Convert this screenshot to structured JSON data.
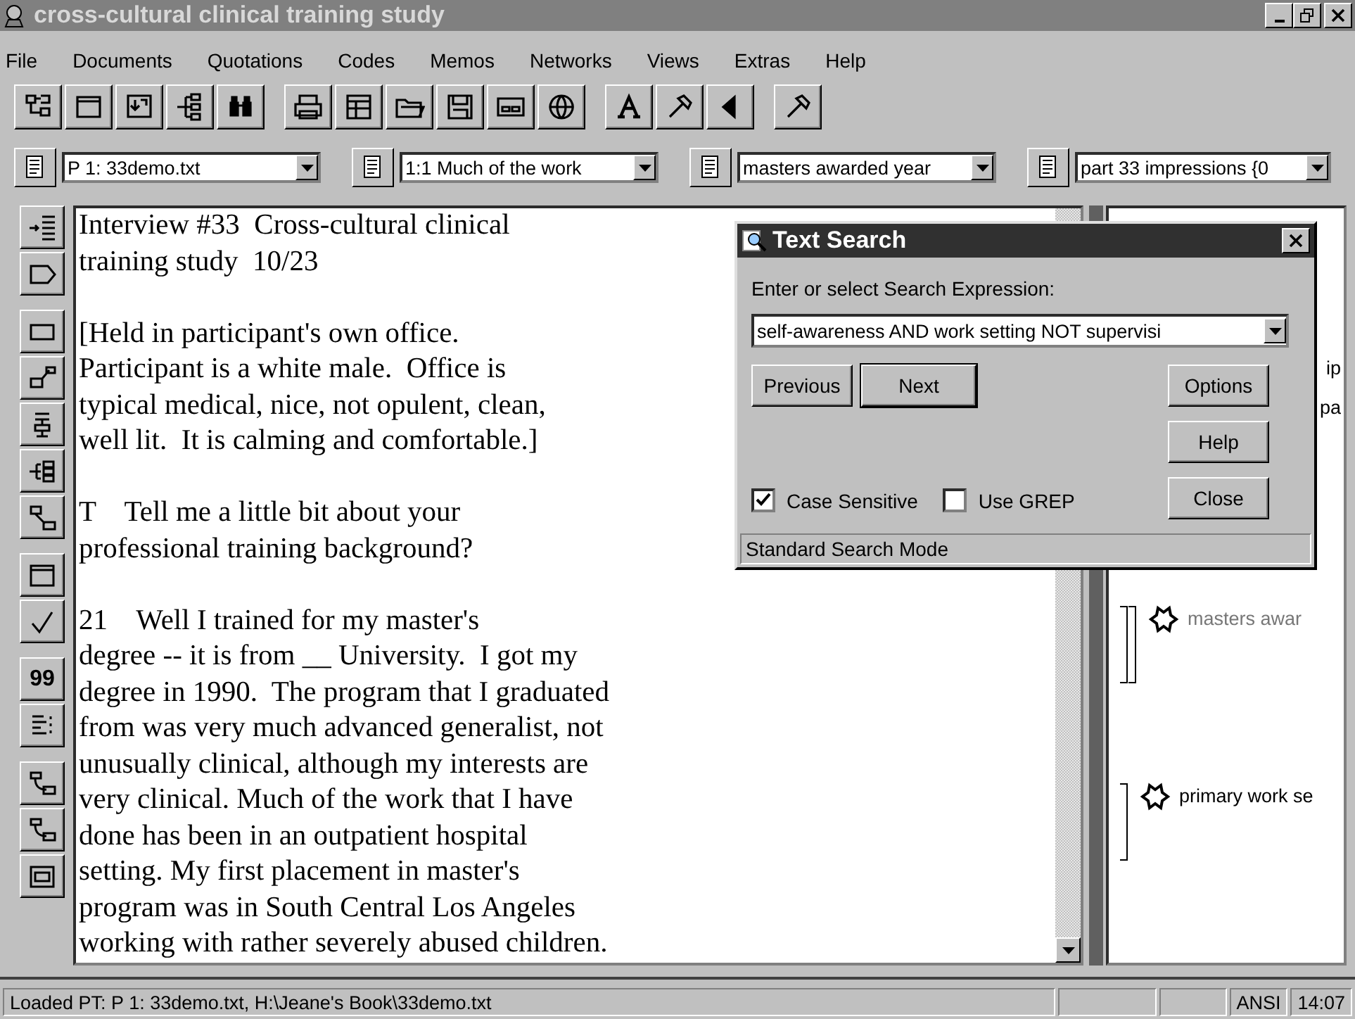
{
  "window": {
    "title": "cross-cultural clinical training study"
  },
  "menu": [
    "File",
    "Documents",
    "Quotations",
    "Codes",
    "Memos",
    "Networks",
    "Views",
    "Extras",
    "Help"
  ],
  "toolbar": [
    {
      "kind": "network"
    },
    {
      "kind": "window"
    },
    {
      "kind": "import"
    },
    {
      "kind": "tree"
    },
    {
      "kind": "binoculars"
    },
    {
      "kind": "gap"
    },
    {
      "kind": "printer"
    },
    {
      "kind": "table"
    },
    {
      "kind": "folder"
    },
    {
      "kind": "disk"
    },
    {
      "kind": "panel"
    },
    {
      "kind": "globe"
    },
    {
      "kind": "gap"
    },
    {
      "kind": "font"
    },
    {
      "kind": "hammer"
    },
    {
      "kind": "back"
    },
    {
      "kind": "gap"
    },
    {
      "kind": "hammer"
    }
  ],
  "selectors": [
    {
      "value": "P 1: 33demo.txt"
    },
    {
      "value": "1:1 Much of the work"
    },
    {
      "value": "masters awarded year"
    },
    {
      "value": "part 33 impressions {0"
    }
  ],
  "side_tools": [
    {
      "kind": "indent"
    },
    {
      "kind": "tag"
    },
    {
      "kind": "gap"
    },
    {
      "kind": "rect"
    },
    {
      "kind": "link"
    },
    {
      "kind": "tree"
    },
    {
      "kind": "branch"
    },
    {
      "kind": "connect"
    },
    {
      "kind": "gap"
    },
    {
      "kind": "window"
    },
    {
      "kind": "check"
    },
    {
      "kind": "gap"
    },
    {
      "kind": "quote",
      "label": "99"
    },
    {
      "kind": "lines"
    },
    {
      "kind": "gap"
    },
    {
      "kind": "flow"
    },
    {
      "kind": "flow"
    },
    {
      "kind": "screen"
    }
  ],
  "document": {
    "paragraphs": [
      [
        "Interview #33  Cross-cultural clinical",
        "training study  10/23"
      ],
      [
        "[Held in participant's own office.",
        "Participant is a white male.  Office is",
        "typical medical, nice, not opulent, clean,",
        "well lit.  It is calming and comfortable.]"
      ],
      [
        "T    Tell me a little bit about your",
        "professional training background?"
      ],
      [
        "21    Well I trained for my master's",
        "degree -- it is from __ University.  I got my",
        "degree in 1990.  The program that I graduated",
        "from was very much advanced generalist, not",
        "unusually clinical, although my interests are",
        "very clinical. Much of the work that I have",
        "done has been in an outpatient hospital",
        "setting. My first placement in master's",
        "program was in South Central Los Angeles",
        "working with rather severely abused children."
      ]
    ]
  },
  "margin": {
    "fragments": [
      "ip",
      "pa"
    ],
    "codes": [
      {
        "label": "masters awar",
        "kind": "double"
      },
      {
        "label": "primary work se",
        "kind": "single"
      }
    ]
  },
  "dialog": {
    "title": "Text Search",
    "prompt": "Enter or select Search Expression:",
    "expression": "self-awareness AND work setting NOT supervisi",
    "buttons": [
      {
        "label": "Previous",
        "default": false
      },
      {
        "label": "Next",
        "default": true
      },
      {
        "label": "Options",
        "default": false
      },
      {
        "label": "Help",
        "default": false
      },
      {
        "label": "Close",
        "default": false
      }
    ],
    "options": [
      {
        "label": "Case Sensitive",
        "checked": true
      },
      {
        "label": "Use GREP",
        "checked": false
      }
    ],
    "status": "Standard Search Mode"
  },
  "status_bar": {
    "message": "Loaded PT: P 1: 33demo.txt, H:\\Jeane's Book\\33demo.txt",
    "encoding": "ANSI",
    "time": "14:07"
  }
}
